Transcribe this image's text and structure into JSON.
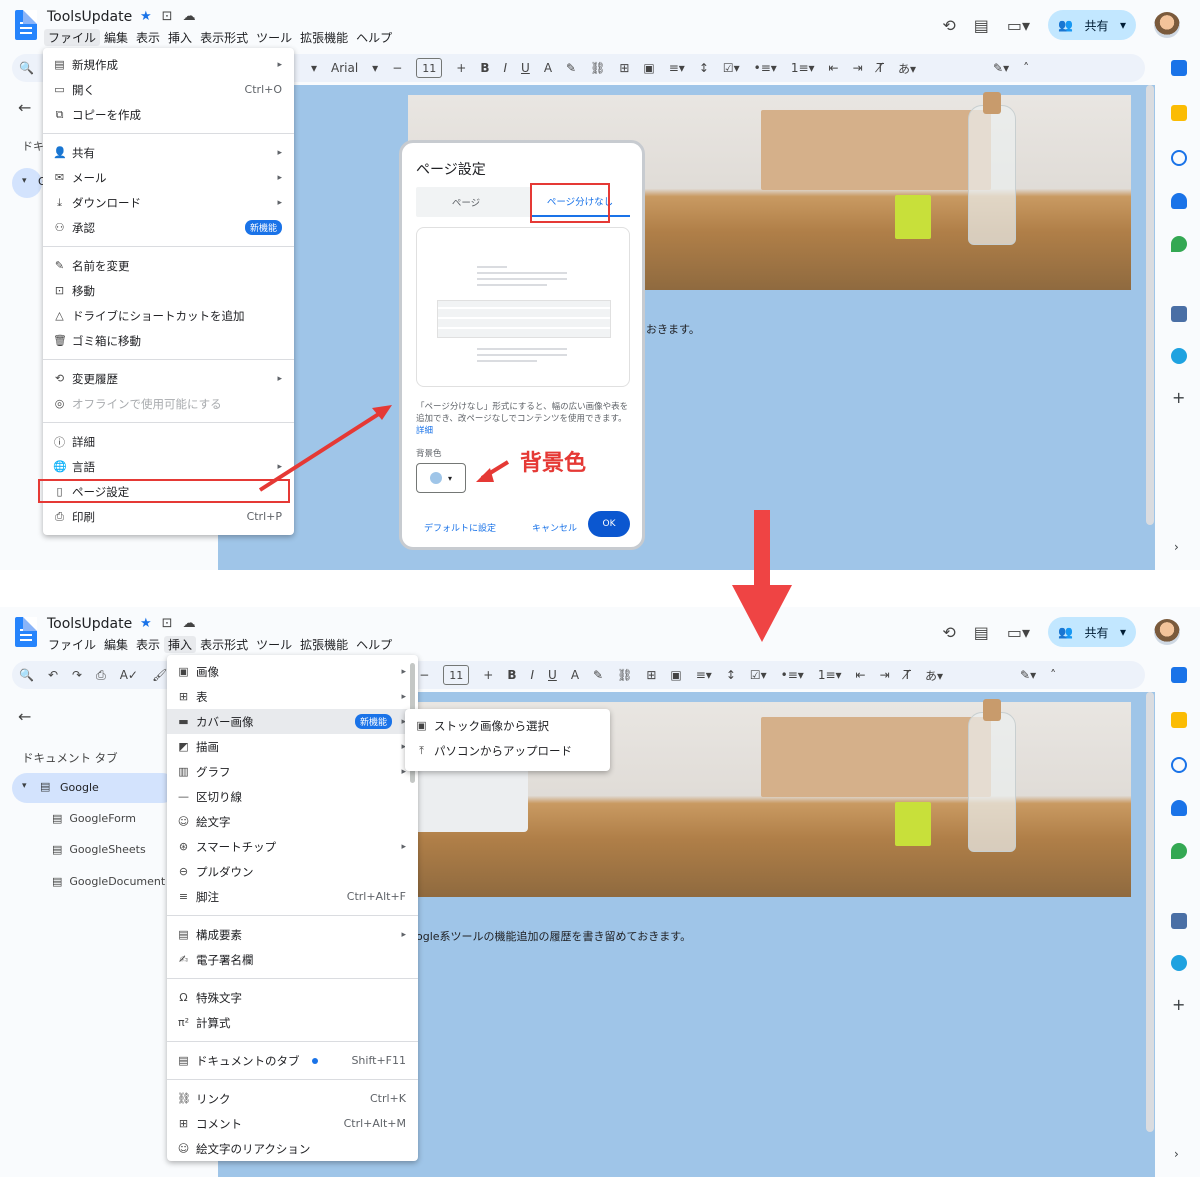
{
  "app": {
    "title": "ToolsUpdate",
    "share_label": "共有"
  },
  "menubar": [
    "ファイル",
    "編集",
    "表示",
    "挿入",
    "表示形式",
    "ツール",
    "拡張機能",
    "ヘルプ"
  ],
  "toolbar": {
    "font": "Arial",
    "size": "11"
  },
  "file_menu": {
    "items": [
      {
        "label": "新規作成",
        "icon": "doc-icon",
        "arrow": true
      },
      {
        "label": "開く",
        "icon": "folder-icon",
        "shortcut": "Ctrl+O"
      },
      {
        "label": "コピーを作成",
        "icon": "copy-icon"
      },
      {
        "label": "共有",
        "icon": "add-person-icon",
        "arrow": true
      },
      {
        "label": "メール",
        "icon": "mail-icon",
        "arrow": true
      },
      {
        "label": "ダウンロード",
        "icon": "download-icon",
        "arrow": true
      },
      {
        "label": "承認",
        "icon": "approval-icon",
        "badge": "新機能"
      },
      {
        "label": "名前を変更",
        "icon": "rename-icon"
      },
      {
        "label": "移動",
        "icon": "move-icon"
      },
      {
        "label": "ドライブにショートカットを追加",
        "icon": "drive-shortcut-icon"
      },
      {
        "label": "ゴミ箱に移動",
        "icon": "trash-icon"
      },
      {
        "label": "変更履歴",
        "icon": "history-icon",
        "arrow": true
      },
      {
        "label": "オフラインで使用可能にする",
        "icon": "offline-icon",
        "disabled": true
      },
      {
        "label": "詳細",
        "icon": "info-icon"
      },
      {
        "label": "言語",
        "icon": "globe-icon",
        "arrow": true
      },
      {
        "label": "ページ設定",
        "icon": "page-icon",
        "highlight": true
      },
      {
        "label": "印刷",
        "icon": "print-icon",
        "shortcut": "Ctrl+P"
      }
    ]
  },
  "page_setup": {
    "title": "ページ設定",
    "tab_pages": "ページ",
    "tab_pageless": "ページ分けなし",
    "note": "「ページ分けなし」形式にすると、幅の広い画像や表を追加でき、改ページなしでコンテンツを使用できます。",
    "learn_more": "詳細",
    "bg_label": "背景色",
    "bg_color": "#9fc5e8",
    "default_btn": "デフォルトに設定",
    "cancel_btn": "キャンセル",
    "ok_btn": "OK"
  },
  "annotation": "背景色",
  "doc": {
    "partial_text_top": "おきます。",
    "partial_text_bottom": "ogle系ツールの機能追加の履歴を書き留めておきます。",
    "left_fragment_1": "ドキ",
    "left_fragment_2": "G"
  },
  "left_panel": {
    "header": "ドキュメント タブ",
    "tabs": [
      {
        "label": "Google",
        "selected": true
      },
      {
        "label": "GoogleForm"
      },
      {
        "label": "GoogleSheets"
      },
      {
        "label": "GoogleDocument"
      }
    ]
  },
  "insert_menu": {
    "items": [
      {
        "label": "画像",
        "icon": "image-icon",
        "arrow": true
      },
      {
        "label": "表",
        "icon": "table-icon",
        "arrow": true
      },
      {
        "label": "カバー画像",
        "icon": "cover-image-icon",
        "badge": "新機能",
        "arrow": true,
        "hl": true
      },
      {
        "label": "描画",
        "icon": "drawing-icon",
        "arrow": true
      },
      {
        "label": "グラフ",
        "icon": "chart-icon",
        "arrow": true
      },
      {
        "label": "区切り線",
        "icon": "line-icon"
      },
      {
        "label": "絵文字",
        "icon": "emoji-icon"
      },
      {
        "label": "スマートチップ",
        "icon": "smartchip-icon",
        "arrow": true
      },
      {
        "label": "プルダウン",
        "icon": "dropdown-icon"
      },
      {
        "label": "脚注",
        "icon": "footnote-icon",
        "shortcut": "Ctrl+Alt+F"
      },
      {
        "label": "構成要素",
        "icon": "building-blocks-icon",
        "arrow": true
      },
      {
        "label": "電子署名欄",
        "icon": "signature-icon"
      },
      {
        "label": "特殊文字",
        "icon": "omega-icon"
      },
      {
        "label": "計算式",
        "icon": "pi-icon"
      },
      {
        "label": "ドキュメントのタブ",
        "icon": "doc-tabs-icon",
        "shortcut": "Shift+F11"
      },
      {
        "label": "リンク",
        "icon": "link-icon",
        "shortcut": "Ctrl+K"
      },
      {
        "label": "コメント",
        "icon": "comment-icon",
        "shortcut": "Ctrl+Alt+M"
      },
      {
        "label": "絵文字のリアクション",
        "icon": "emoji-reaction-icon"
      }
    ],
    "cover_submenu": [
      "ストック画像から選択",
      "パソコンからアップロード"
    ]
  }
}
